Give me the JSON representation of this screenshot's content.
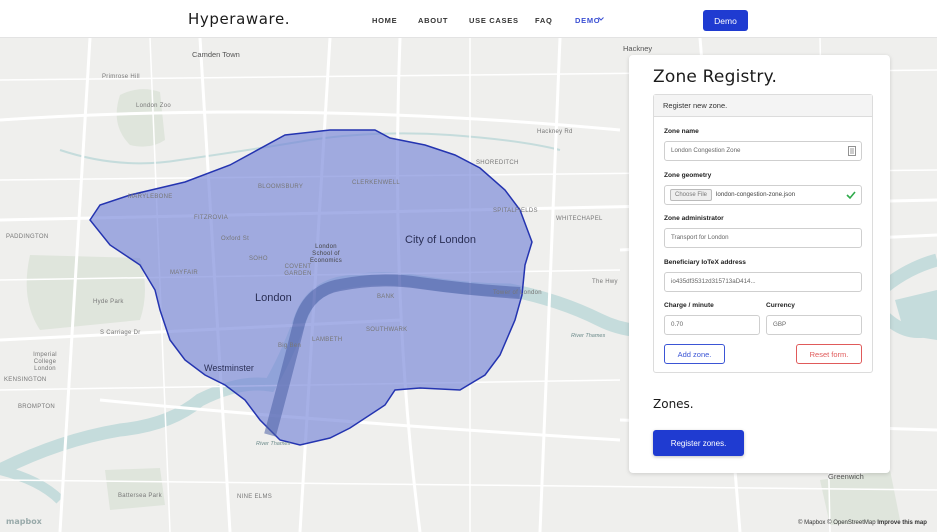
{
  "nav": {
    "brand": "Hyperaware.",
    "links": [
      "HOME",
      "ABOUT",
      "USE CASES",
      "FAQ",
      "DEMO"
    ],
    "demo_button": "Demo"
  },
  "map": {
    "labels": {
      "camden_town": "Camden Town",
      "hackney": "Hackney",
      "primrose_hill": "Primrose Hill",
      "london_zoo": "London Zoo",
      "paddington": "PADDINGTON",
      "marylebone": "MARYLEBONE",
      "fitzrovia": "FITZROVIA",
      "bloomsbury": "BLOOMSBURY",
      "clerkenwell": "CLERKENWELL",
      "shoreditch": "SHOREDITCH",
      "spitalfields": "SPITALFIELDS",
      "whitechapel": "WHITECHAPEL",
      "city_of_london": "City of London",
      "lse": "London School of Economics",
      "soho": "SOHO",
      "covent_garden": "COVENT GARDEN",
      "mayfair": "MAYFAIR",
      "london": "London",
      "hyde_park": "Hyde Park",
      "bank": "BANK",
      "tower_of_london": "Tower of London",
      "southwark": "SOUTHWARK",
      "westminster": "Westminster",
      "lambeth": "LAMBETH",
      "big_ben": "Big Ben",
      "imperial_college": "Imperial College London",
      "kensington": "KENSINGTON",
      "brompton": "BROMPTON",
      "river_thames": "River Thames",
      "the_highway": "The Hwy",
      "greenwich": "Greenwich",
      "nine_elms": "NINE ELMS",
      "battersea_park": "Battersea Park",
      "oxford_st": "Oxford St",
      "hackney_rd": "Hackney Rd",
      "s_carriage_dr": "S Carriage Dr"
    },
    "attribution": "© Mapbox © OpenStreetMap",
    "improve": "Improve this map",
    "logo": "mapbox",
    "zone_color": "#6f7fd6",
    "zone_border": "#2434b0",
    "water_color": "#c5dcdc",
    "park_color": "#dfe5dc"
  },
  "panel": {
    "title": "Zone Registry.",
    "form_header": "Register new zone.",
    "fields": {
      "zone_name_label": "Zone name",
      "zone_name_value": "London Congestion Zone",
      "zone_geometry_label": "Zone geometry",
      "choose_file": "Choose File",
      "file_name": "london-congestion-zone.json",
      "zone_admin_label": "Zone administrator",
      "zone_admin_value": "Transport for London",
      "beneficiary_label": "Beneficiary IoTeX address",
      "beneficiary_value": "io435df3531zd315713aD414...",
      "charge_label": "Charge / minute",
      "charge_value": "0.70",
      "currency_label": "Currency",
      "currency_value": "GBP"
    },
    "add_zone": "Add zone.",
    "reset_form": "Reset form.",
    "zones_title": "Zones.",
    "register_zones": "Register zones."
  }
}
